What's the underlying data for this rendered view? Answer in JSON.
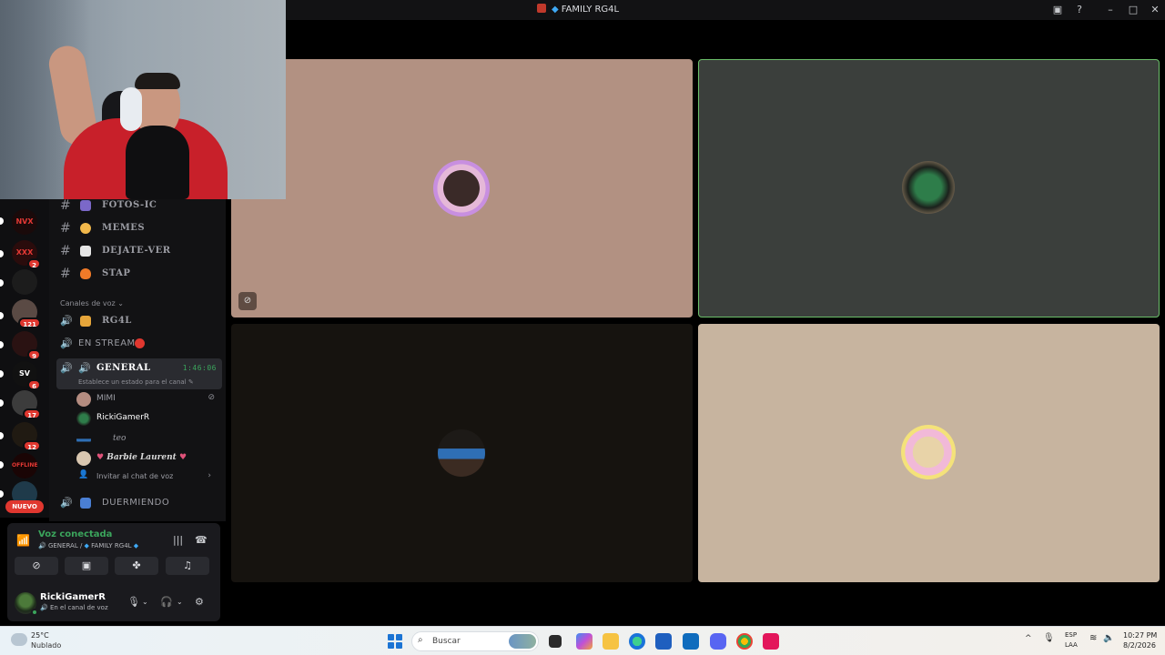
{
  "titlebar": {
    "title": "FAMILY RG4L",
    "inbox_icon": "inbox-icon",
    "help_icon": "help-icon"
  },
  "rail": {
    "servers": [
      {
        "name": "NVX",
        "badge": ""
      },
      {
        "name": "XXX",
        "badge": "2"
      },
      {
        "name": "",
        "badge": ""
      },
      {
        "name": "",
        "badge": "121"
      },
      {
        "name": "",
        "badge": "9"
      },
      {
        "name": "SV",
        "badge": "6"
      },
      {
        "name": "",
        "badge": "17"
      },
      {
        "name": "",
        "badge": "12"
      },
      {
        "name": "OFFLINE",
        "badge": ""
      },
      {
        "name": "",
        "badge": ""
      }
    ],
    "new_label": "NUEVO"
  },
  "sidebar": {
    "text_channels": [
      {
        "label": "FOTOS-IC"
      },
      {
        "label": "MEMES"
      },
      {
        "label": "DEJATE-VER"
      },
      {
        "label": "STAP"
      }
    ],
    "voice_category": "Canales de voz",
    "voice_channels": {
      "rg4l": "RG4L",
      "en_stream": "EN STREAM",
      "general": "GENERAL",
      "general_time": "1:46:06",
      "general_status": "Establece un estado para el canal",
      "duermiendo": "DUERMIENDO"
    },
    "members": [
      {
        "name": "MIMI"
      },
      {
        "name": "RickiGamerR"
      },
      {
        "name": "teo"
      },
      {
        "name": "Barbie Laurent"
      }
    ],
    "invite": "Invitar al chat de voz"
  },
  "voice_panel": {
    "title": "Voz conectada",
    "channel": "GENERAL",
    "server": "FAMILY RG4L"
  },
  "user": {
    "name": "RickiGamerR",
    "status": "En el canal de voz"
  },
  "taskbar": {
    "temp": "25°C",
    "weather": "Nublado",
    "search_placeholder": "Buscar",
    "lang1": "ESP",
    "lang2": "LAA",
    "time": "10:27 PM",
    "date": "8/2/2026"
  },
  "colors": {
    "accent_green": "#3ba55c",
    "badge_red": "#e0372f"
  }
}
